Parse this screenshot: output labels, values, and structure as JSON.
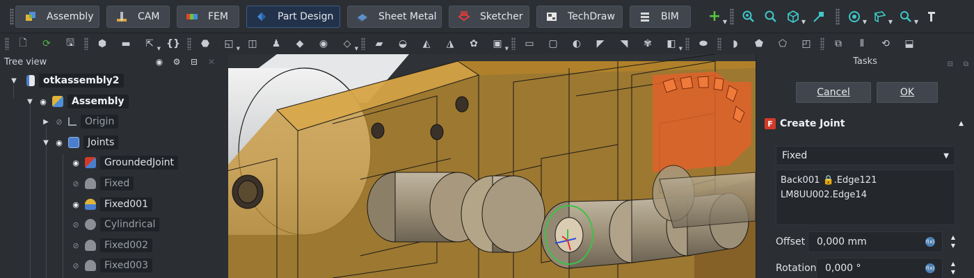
{
  "workbenches": [
    "Assembly",
    "CAM",
    "FEM",
    "Part Design",
    "Sheet Metal",
    "Sketcher",
    "TechDraw",
    "BIM"
  ],
  "active_workbench": "Part Design",
  "tree": {
    "title": "Tree view",
    "items": [
      {
        "label": "otkassembly2"
      },
      {
        "label": "Assembly"
      },
      {
        "label": "Origin"
      },
      {
        "label": "Joints"
      },
      {
        "label": "GroundedJoint"
      },
      {
        "label": "Fixed"
      },
      {
        "label": "Fixed001"
      },
      {
        "label": "Cylindrical"
      },
      {
        "label": "Fixed002"
      },
      {
        "label": "Fixed003"
      }
    ]
  },
  "tasks": {
    "title": "Tasks",
    "cancel_label": "Cancel",
    "ok_label": "OK",
    "section_title": "Create Joint",
    "joint_type": "Fixed",
    "references": [
      "Back001 🔒.Edge121",
      "LM8UU002.Edge14"
    ],
    "offset_label": "Offset",
    "offset_value": "0,000 mm",
    "rotation_label": "Rotation",
    "rotation_value": "0,000 °"
  },
  "colors": {
    "background": "#2b2e33",
    "viewport_bg": "#2f3338",
    "model_amber": "#c8932f",
    "gear_orange": "#e0622a",
    "active_workbench": "#22324a"
  }
}
